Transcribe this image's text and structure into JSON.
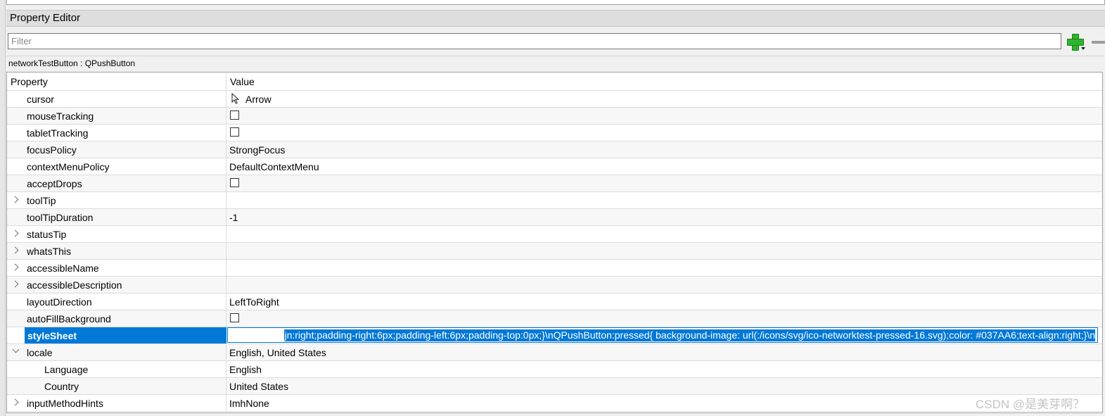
{
  "panel": {
    "title": "Property Editor",
    "filter_placeholder": "Filter",
    "object_label": "networkTestButton : QPushButton"
  },
  "grid": {
    "header_property": "Property",
    "header_value": "Value",
    "rows": [
      {
        "name": "cursor",
        "value": "Arrow",
        "kind": "cursor",
        "icon": "arrow-cursor-icon"
      },
      {
        "name": "mouseTracking",
        "kind": "checkbox",
        "checked": false
      },
      {
        "name": "tabletTracking",
        "kind": "checkbox",
        "checked": false
      },
      {
        "name": "focusPolicy",
        "value": "StrongFocus",
        "kind": "text"
      },
      {
        "name": "contextMenuPolicy",
        "value": "DefaultContextMenu",
        "kind": "text"
      },
      {
        "name": "acceptDrops",
        "kind": "checkbox",
        "checked": false
      },
      {
        "name": "toolTip",
        "value": "",
        "kind": "expand"
      },
      {
        "name": "toolTipDuration",
        "value": "-1",
        "kind": "text"
      },
      {
        "name": "statusTip",
        "value": "",
        "kind": "expand"
      },
      {
        "name": "whatsThis",
        "value": "",
        "kind": "expand"
      },
      {
        "name": "accessibleName",
        "value": "",
        "kind": "expand"
      },
      {
        "name": "accessibleDescription",
        "value": "",
        "kind": "expand"
      },
      {
        "name": "layoutDirection",
        "value": "LeftToRight",
        "kind": "text"
      },
      {
        "name": "autoFillBackground",
        "kind": "checkbox",
        "checked": false
      },
      {
        "name": "styleSheet",
        "value": "jn:right;padding-right:6px;padding-left:6px;padding-top:0px;}\\nQPushButton:pressed{ background-image: url(:/icons/svg/ico-networktest-pressed-16.svg);color: #037AA6;text-align:right;}\\n",
        "kind": "editing"
      },
      {
        "name": "locale",
        "value": "English, United States",
        "kind": "expanded"
      },
      {
        "name": "Language",
        "value": "English",
        "kind": "sub"
      },
      {
        "name": "Country",
        "value": "United States",
        "kind": "sub"
      },
      {
        "name": "inputMethodHints",
        "value": "ImhNone",
        "kind": "expand"
      }
    ]
  },
  "watermark": "CSDN @是美芽啊？",
  "colors": {
    "selection": "#0078d7",
    "add_icon": "#2fb42f"
  }
}
